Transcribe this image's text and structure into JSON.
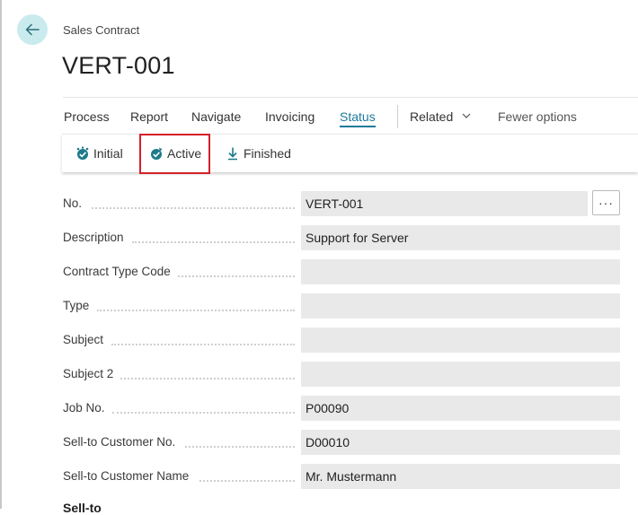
{
  "breadcrumb": "Sales Contract",
  "title": "VERT-001",
  "actions": {
    "process": "Process",
    "report": "Report",
    "navigate": "Navigate",
    "invoicing": "Invoicing",
    "status": "Status",
    "related": "Related",
    "fewer_options": "Fewer options"
  },
  "status_actions": {
    "initial": "Initial",
    "active": "Active",
    "finished": "Finished"
  },
  "fields": {
    "no": {
      "label": "No.",
      "value": "VERT-001"
    },
    "description": {
      "label": "Description",
      "value": "Support for Server"
    },
    "contract_type_code": {
      "label": "Contract Type Code",
      "value": ""
    },
    "type": {
      "label": "Type",
      "value": ""
    },
    "subject": {
      "label": "Subject",
      "value": ""
    },
    "subject2": {
      "label": "Subject 2",
      "value": ""
    },
    "job_no": {
      "label": "Job No.",
      "value": "P00090"
    },
    "sell_to_customer_no": {
      "label": "Sell-to Customer No.",
      "value": "D00010"
    },
    "sell_to_customer_name": {
      "label": "Sell-to Customer Name",
      "value": "Mr. Mustermann"
    }
  },
  "lookup_button": "···",
  "section_sell_to": "Sell-to",
  "colors": {
    "accent": "#1c7a9b",
    "highlight": "#d4202b",
    "back_bg": "#c9ebee"
  },
  "icons": {
    "back": "arrow-left-icon",
    "initial": "status-initial-icon",
    "active": "status-active-icon",
    "finished": "download-arrow-icon",
    "related": "chevron-down-icon"
  }
}
